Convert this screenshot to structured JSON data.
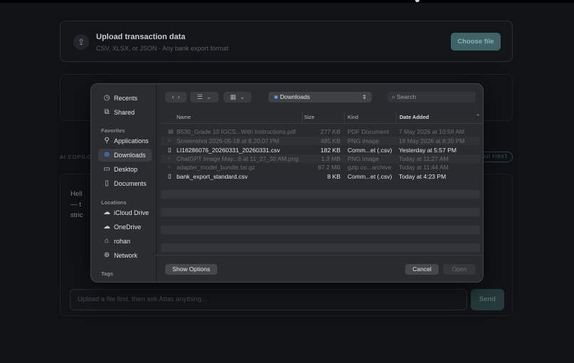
{
  "app": {
    "upload": {
      "title": "Upload transaction data",
      "subtitle": "CSV, XLSX, or JSON · Any bank export format",
      "choose_label": "Choose file"
    },
    "ai_label": "AI COPILOT",
    "ad_first": "AD FIRST",
    "chat": {
      "message_lines": [
        "Hell",
        "— t",
        "stric"
      ],
      "input_placeholder": "Upload a file first, then ask Atlas anything...",
      "send_label": "Send"
    }
  },
  "dialog": {
    "sidebar": {
      "recents": "Recents",
      "shared": "Shared",
      "favorites_head": "Favorites",
      "favorites": [
        "Applications",
        "Downloads",
        "Desktop",
        "Documents"
      ],
      "locations_head": "Locations",
      "locations": [
        "iCloud Drive",
        "OneDrive",
        "rohan",
        "Network"
      ],
      "tags_head": "Tags"
    },
    "toolbar": {
      "back": "‹",
      "forward": "›",
      "list_view": "☰",
      "grid_view": "▦",
      "folder": "Downloads",
      "search_placeholder": "Search"
    },
    "columns": {
      "name": "Name",
      "size": "Size",
      "kind": "Kind",
      "date": "Date Added"
    },
    "files": [
      {
        "name": "B530_Grade 10 IGCS...With Instructions.pdf",
        "size": "277 KB",
        "kind": "PDF Document",
        "date": "7 May 2026 at 10:58 AM",
        "enabled": false
      },
      {
        "name": "Screenshot 2026-05-18 at 8.20.07 PM",
        "size": "485 KB",
        "kind": "PNG image",
        "date": "18 May 2026 at 8:20 PM",
        "enabled": false
      },
      {
        "name": "LI16286076_20260331_20260331.csv",
        "size": "182 KB",
        "kind": "Comm...et (.csv)",
        "date": "Yesterday at 5:57 PM",
        "enabled": true
      },
      {
        "name": "ChatGPT Image May...6 at 11_27_30 AM.png",
        "size": "1.3 MB",
        "kind": "PNG image",
        "date": "Today at 11:27 AM",
        "enabled": false
      },
      {
        "name": "adapter_model_bundle.tar.gz",
        "size": "87.2 MB",
        "kind": "gzip co...archive",
        "date": "Today at 11:44 AM",
        "enabled": false
      },
      {
        "name": "bank_export_standard.csv",
        "size": "8 KB",
        "kind": "Comm...et (.csv)",
        "date": "Today at 4:23 PM",
        "enabled": true
      }
    ],
    "buttons": {
      "show_options": "Show Options",
      "cancel": "Cancel",
      "open": "Open"
    }
  }
}
